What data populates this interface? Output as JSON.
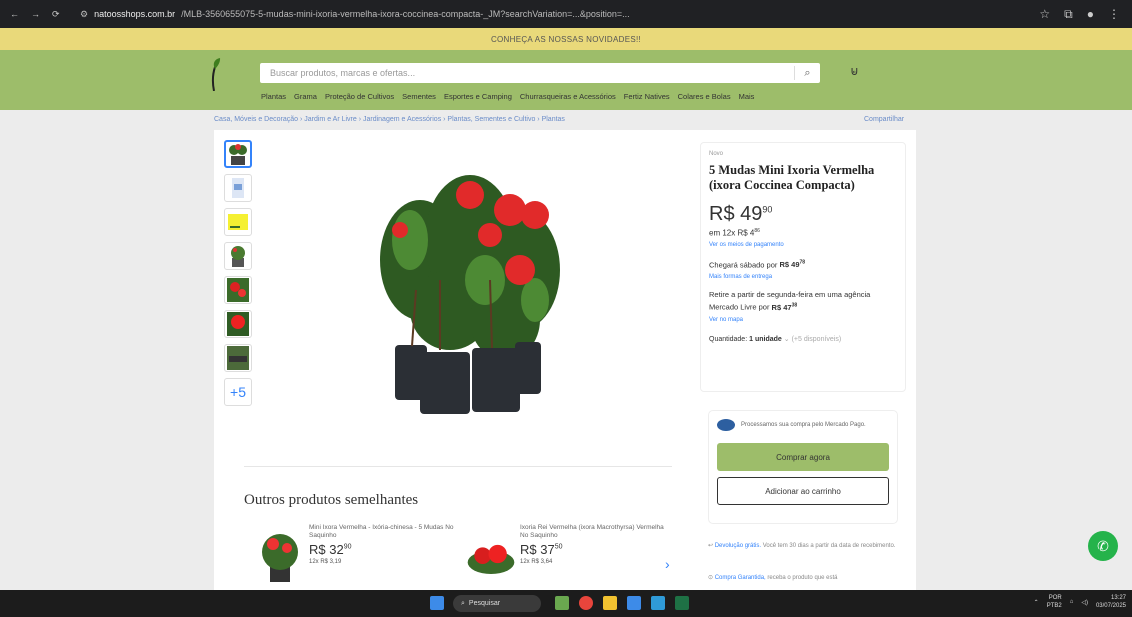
{
  "browser": {
    "url_domain": "natoosshops.com.br",
    "url_path": "/MLB-3560655075-5-mudas-mini-ixoria-vermelha-ixora-coccinea-compacta-_JM?searchVariation=...&position=...",
    "back_icon": "←",
    "forward_icon": "→",
    "reload_icon": "⟳"
  },
  "banner": {
    "text": "CONHEÇA AS NOSSAS NOVIDADES!!"
  },
  "header": {
    "search_placeholder": "Buscar produtos, marcas e ofertas...",
    "search_icon": "⌕",
    "cart_icon": "🛒",
    "categories": [
      "Plantas",
      "Grama",
      "Proteção de Cultivos",
      "Sementes",
      "Esportes e Camping",
      "Churrasqueiras e Acessórios",
      "Fertiz Natives",
      "Colares e Bolas",
      "Mais"
    ]
  },
  "breadcrumb": "Casa, Móveis e Decoração  ›  Jardim e Ar Livre  ›  Jardinagem e Acessórios  ›  Plantas, Sementes e Cultivo  ›  Plantas",
  "share_label": "Compartilhar",
  "thumbs_more": "+5",
  "product": {
    "condition": "Novo",
    "title": "5 Mudas Mini Ixoria Vermelha (ixora Coccinea Compacta)",
    "price_main": "R$ 49",
    "price_cents": "90",
    "installments": "em 12x R$ 4",
    "installments_cents": "86",
    "payment_link": "Ver os meios de pagamento",
    "shipping": "Chegará sábado por",
    "shipping_price": "R$ 49",
    "shipping_price_cents": "78",
    "shipping_link": "Mais formas de entrega",
    "pickup": "Retire a partir de segunda-feira em uma agência Mercado Livre por",
    "pickup_price": "R$ 47",
    "pickup_price_cents": "38",
    "pickup_link": "Ver no mapa",
    "quantity_label": "Quantidade:",
    "quantity_value": "1 unidade",
    "quantity_available": "(+5 disponíveis)"
  },
  "payment_box": {
    "mp_text": "Processamos sua compra pelo Mercado Pago.",
    "buy_now": "Comprar agora",
    "add_cart": "Adicionar ao carrinho"
  },
  "returns": {
    "return_link": "Devolução grátis.",
    "return_text": "Você tem 30 dias a partir da data de recebimento.",
    "warranty_link": "Compra Garantida,",
    "warranty_text": "receba o produto que está"
  },
  "others": {
    "title": "Outros produtos semelhantes",
    "items": [
      {
        "title": "Mini Ixora Vermelha - Ixória-chinesa - 5 Mudas No Saquinho",
        "price": "R$ 32",
        "cents": "90",
        "inst": "12x R$ 3,19"
      },
      {
        "title": "Ixoria Rei Vermelha (ixora Macrothyrsa) Vermelha No Saquinho",
        "price": "R$ 37",
        "cents": "50",
        "inst": "12x R$ 3,64"
      }
    ]
  },
  "taskbar": {
    "search_label": "Pesquisar",
    "lang": "POR",
    "lang2": "PTB2",
    "time": "13:27",
    "date": "03/07/2025"
  },
  "colors": {
    "header_green": "#9dbd6a",
    "banner_yellow": "#e9d97a",
    "link_blue": "#3483fa"
  }
}
